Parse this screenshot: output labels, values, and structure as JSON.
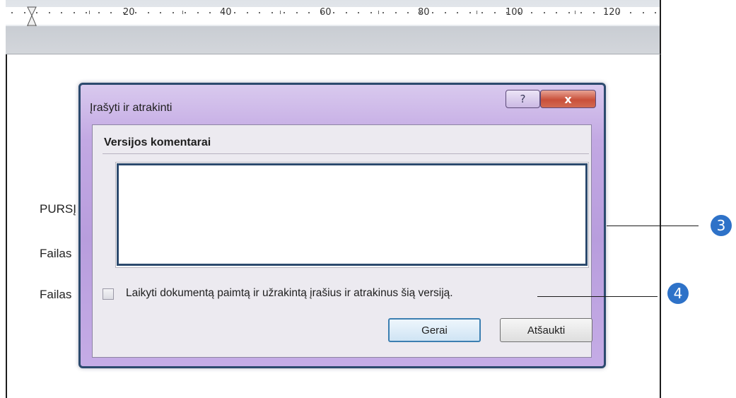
{
  "ruler": {
    "labels": [
      "20",
      "40",
      "60",
      "80",
      "100",
      "120"
    ]
  },
  "document": {
    "lines": [
      "PURSĮ",
      "Failas",
      "Failas"
    ]
  },
  "dialog": {
    "title": "Įrašyti ir atrakinti",
    "help_label": "?",
    "close_label": "x",
    "group_label": "Versijos komentarai",
    "comment_value": "",
    "checkbox_checked": false,
    "checkbox_label": "Laikyti dokumentą paimtą ir užrakintą įrašius ir atrakinus šią versiją.",
    "ok_label": "Gerai",
    "cancel_label": "Atšaukti"
  },
  "callouts": [
    {
      "number": "3"
    },
    {
      "number": "4"
    }
  ],
  "colors": {
    "dialog_frame": "#c2a8e3",
    "dialog_border": "#2c4a6e",
    "close_button": "#c9503a",
    "callout_badge": "#2e72c8"
  }
}
